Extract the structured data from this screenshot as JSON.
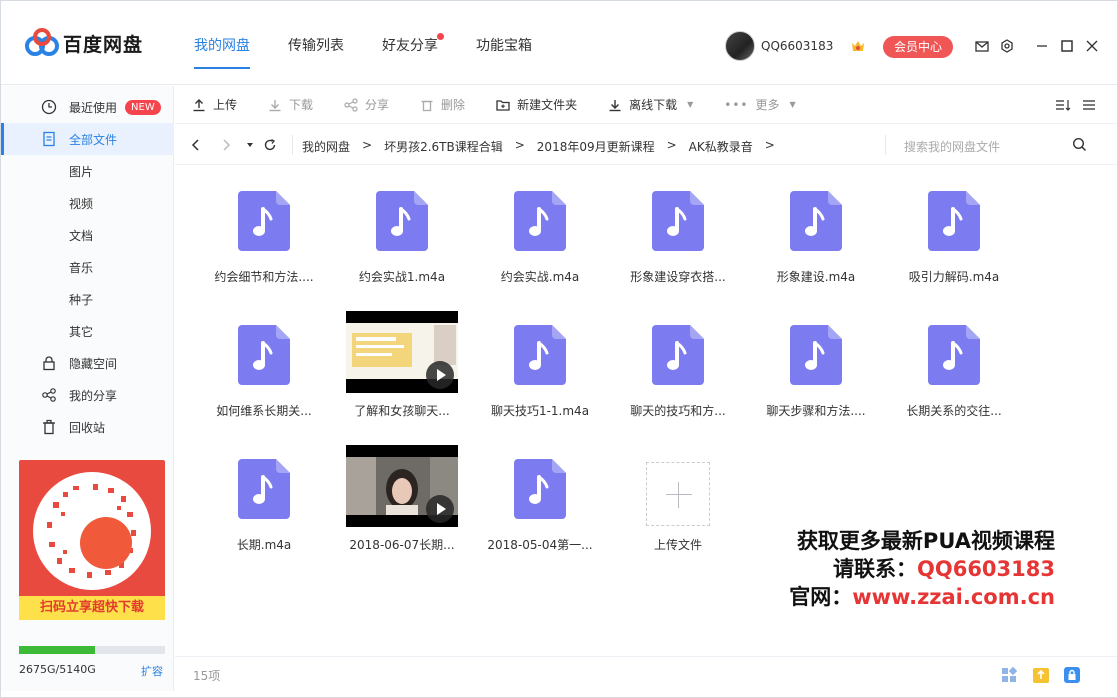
{
  "app": {
    "logo_text": "百度网盘",
    "nav": [
      {
        "label": "我的网盘",
        "active": true
      },
      {
        "label": "传输列表",
        "active": false
      },
      {
        "label": "好友分享",
        "active": false,
        "dot": true
      },
      {
        "label": "功能宝箱",
        "active": false
      }
    ],
    "username": "QQ6603183",
    "vip_button": "会员中心"
  },
  "sidebar": {
    "items": [
      {
        "label": "最近使用",
        "badge": "NEW",
        "icon": "clock-icon"
      },
      {
        "label": "全部文件",
        "icon": "document-icon",
        "active": true
      },
      {
        "label": "图片",
        "sub": true
      },
      {
        "label": "视频",
        "sub": true
      },
      {
        "label": "文档",
        "sub": true
      },
      {
        "label": "音乐",
        "sub": true
      },
      {
        "label": "种子",
        "sub": true
      },
      {
        "label": "其它",
        "sub": true
      },
      {
        "label": "隐藏空间",
        "icon": "lock-icon"
      },
      {
        "label": "我的分享",
        "icon": "share-icon"
      },
      {
        "label": "回收站",
        "icon": "trash-icon"
      }
    ],
    "promo_text": "扫码立享超快下载",
    "quota": {
      "used": "2675G",
      "total": "5140G",
      "text": "2675G/5140G",
      "fraction": 0.52
    },
    "expand": "扩容"
  },
  "toolbar": {
    "upload": "上传",
    "download": "下载",
    "share": "分享",
    "delete": "删除",
    "new_folder": "新建文件夹",
    "offline_download": "离线下载",
    "more": "更多"
  },
  "breadcrumb": {
    "items": [
      "我的网盘",
      "坏男孩2.6TB课程合辑",
      "2018年09月更新课程",
      "AK私教录音"
    ],
    "separator": ">",
    "search_placeholder": "搜索我的网盘文件"
  },
  "files": [
    {
      "name": "约会细节和方法....",
      "type": "audio"
    },
    {
      "name": "约会实战1.m4a",
      "type": "audio"
    },
    {
      "name": "约会实战.m4a",
      "type": "audio"
    },
    {
      "name": "形象建设穿衣搭...",
      "type": "audio"
    },
    {
      "name": "形象建设.m4a",
      "type": "audio"
    },
    {
      "name": "吸引力解码.m4a",
      "type": "audio"
    },
    {
      "name": "如何维系长期关...",
      "type": "audio"
    },
    {
      "name": "了解和女孩聊天...",
      "type": "video"
    },
    {
      "name": "聊天技巧1-1.m4a",
      "type": "audio"
    },
    {
      "name": "聊天的技巧和方...",
      "type": "audio"
    },
    {
      "name": "聊天步骤和方法....",
      "type": "audio"
    },
    {
      "name": "长期关系的交往...",
      "type": "audio"
    },
    {
      "name": "长期.m4a",
      "type": "audio"
    },
    {
      "name": "2018-06-07长期...",
      "type": "video"
    },
    {
      "name": "2018-05-04第一...",
      "type": "audio"
    },
    {
      "name": "上传文件",
      "type": "upload"
    }
  ],
  "watermark": {
    "line1": "获取更多最新PUA视频课程",
    "line2_key": "请联系：",
    "line2_val": "QQ6603183",
    "line3_key": "官网：",
    "line3_val": "www.zzai.com.cn"
  },
  "status": {
    "count": "15项"
  },
  "colors": {
    "accent": "#2a82e4",
    "audio_icon": "#7c7cf0",
    "vip": "#f05656",
    "quota": "#3dbb38"
  }
}
